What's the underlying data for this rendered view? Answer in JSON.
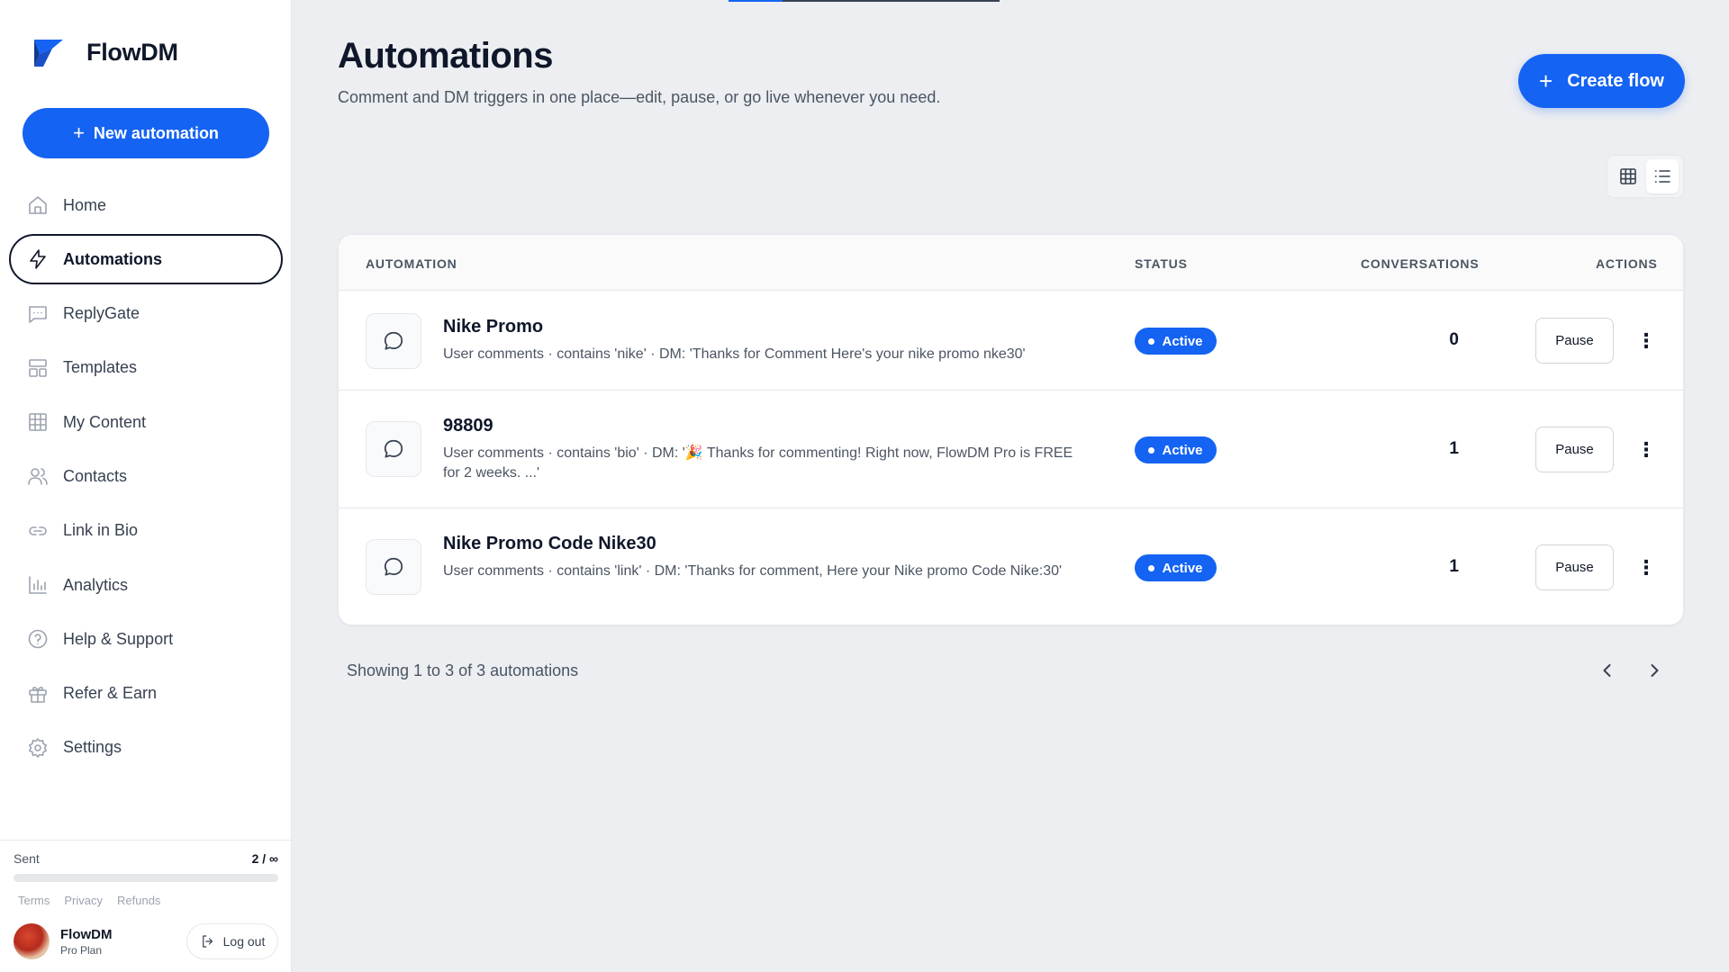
{
  "app": {
    "name": "FlowDM"
  },
  "sidebar": {
    "new_button": "New automation",
    "items": [
      {
        "label": "Home",
        "icon": "home-icon",
        "active": false
      },
      {
        "label": "Automations",
        "icon": "lightning-icon",
        "active": true
      },
      {
        "label": "ReplyGate",
        "icon": "message-square-icon",
        "active": false
      },
      {
        "label": "Templates",
        "icon": "layout-icon",
        "active": false
      },
      {
        "label": "My Content",
        "icon": "grid-icon",
        "active": false
      },
      {
        "label": "Contacts",
        "icon": "users-icon",
        "active": false
      },
      {
        "label": "Link in Bio",
        "icon": "link-icon",
        "active": false
      },
      {
        "label": "Analytics",
        "icon": "bar-chart-icon",
        "active": false
      },
      {
        "label": "Help & Support",
        "icon": "help-circle-icon",
        "active": false
      },
      {
        "label": "Refer & Earn",
        "icon": "gift-icon",
        "active": false
      },
      {
        "label": "Settings",
        "icon": "gear-icon",
        "active": false
      }
    ],
    "sent": {
      "label": "Sent",
      "count": "2 / ∞",
      "progress_fraction": 0
    },
    "footer_links": [
      "Terms",
      "Privacy",
      "Refunds"
    ],
    "user": {
      "name": "FlowDM",
      "plan": "Pro Plan"
    },
    "logout_label": "Log out"
  },
  "main": {
    "title": "Automations",
    "subtitle": "Comment and DM triggers in one place—edit, pause, or go live whenever you need.",
    "create_button": "Create flow",
    "view_mode": "list",
    "table": {
      "headers": {
        "automation": "AUTOMATION",
        "status": "STATUS",
        "conversations": "CONVERSATIONS",
        "actions": "ACTIONS"
      },
      "rows": [
        {
          "title": "Nike Promo",
          "description": "User comments · contains 'nike' · DM: 'Thanks for Comment Here's your nike promo nke30'",
          "status": "Active",
          "conversations": "0",
          "action": "Pause"
        },
        {
          "title": "98809",
          "description": "User comments · contains 'bio' · DM: '🎉 Thanks for commenting! Right now, FlowDM Pro is FREE for 2 weeks. ...'",
          "status": "Active",
          "conversations": "1",
          "action": "Pause"
        },
        {
          "title": "Nike Promo Code Nike30",
          "description": "User comments · contains 'link' · DM: 'Thanks for comment, Here your Nike promo Code Nike:30'",
          "status": "Active",
          "conversations": "1",
          "action": "Pause"
        }
      ]
    },
    "pagination_text": "Showing 1 to 3 of 3 automations"
  },
  "colors": {
    "accent": "#1463f3",
    "background": "#eceef1",
    "text": "#0f172a"
  }
}
